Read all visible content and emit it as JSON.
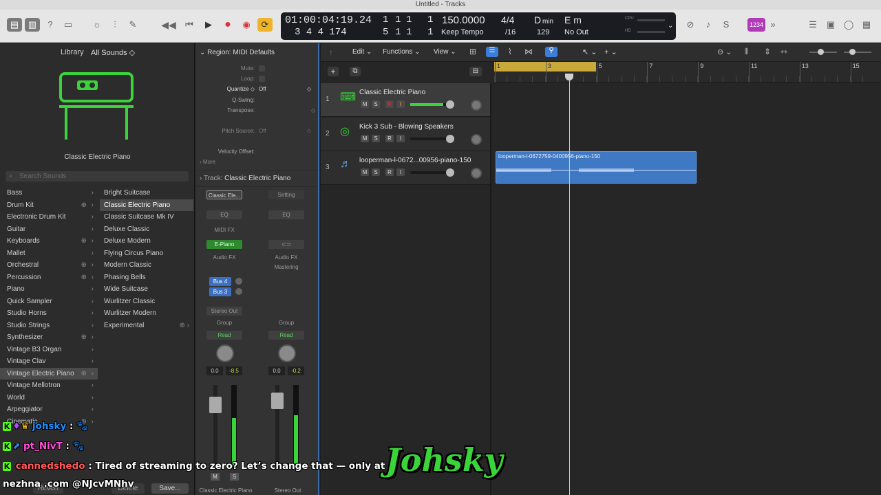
{
  "window": {
    "title": "Untitled - Tracks"
  },
  "lcd": {
    "smpte": "01:00:04:19.24",
    "smpte_sub": "3 4 4 174",
    "bars_top": [
      "1",
      "1",
      "1",
      "1"
    ],
    "bars_bottom": [
      "5",
      "1",
      "1",
      "1"
    ],
    "tempo": "150.0000",
    "tempo_mode": "Keep Tempo",
    "sig_top": "4/4",
    "sig_bottom": "/16",
    "key": "D",
    "key_sub": "min",
    "key_count": "129",
    "chord": "E m",
    "chord_sub": "No Out",
    "cpu": "CPU",
    "hd": "HD",
    "count_in": "1234"
  },
  "library": {
    "title": "Library",
    "filter": "All Sounds ◇",
    "patch_name": "Classic Electric Piano",
    "search_placeholder": "Search Sounds",
    "categories": [
      "Bass",
      "Drum Kit",
      "Electronic Drum Kit",
      "Guitar",
      "Keyboards",
      "Mallet",
      "Orchestral",
      "Percussion",
      "Piano",
      "Quick Sampler",
      "Studio Horns",
      "Studio Strings",
      "Synthesizer",
      "Vintage B3 Organ",
      "Vintage Clav",
      "Vintage Electric Piano",
      "Vintage Mellotron",
      "World",
      "Arpeggiator",
      "Cinematic"
    ],
    "sounds": [
      "Bright Suitcase",
      "Classic Electric Piano",
      "Classic Suitcase Mk IV",
      "Deluxe Classic",
      "Deluxe Modern",
      "Flying Circus Piano",
      "Modern Classic",
      "Phasing Bells",
      "Wide Suitcase",
      "Wurlitzer Classic",
      "Wurlitzer Modern",
      "Experimental"
    ],
    "revert": "Revert",
    "delete": "Delete",
    "save": "Save..."
  },
  "inspector": {
    "region_title": "Region: MIDI Defaults",
    "mute": "Mute:",
    "loop": "Loop:",
    "quantize": "Quantize ◇",
    "quantize_val": "Off",
    "qswing": "Q-Swing:",
    "transpose": "Transpose:",
    "pitch_source": "Pitch Source:",
    "pitch_val": "Off",
    "velocity": "Velocity Offset:",
    "more": "More",
    "track_title": "Track:",
    "track_name": "Classic Electric Piano",
    "strip1": {
      "name": "Classic Ele...",
      "eq": "EQ",
      "midifx": "MIDI FX",
      "inst": "E-Piano",
      "audiofx": "Audio FX",
      "bus1": "Bus 4",
      "bus2": "Bus 3",
      "out": "Stereo Out",
      "group": "Group",
      "read": "Read",
      "pan": "0.0",
      "level": "-8.5",
      "label": "Classic Electric Piano"
    },
    "strip2": {
      "name": "Setting",
      "eq": "EQ",
      "audiofx": "Audio FX",
      "mastering": "Mastering",
      "group": "Group",
      "read": "Read",
      "pan": "0.0",
      "level": "-0.2",
      "label": "Stereo Out"
    },
    "mute_btn": "M",
    "solo_btn": "S"
  },
  "tracks_menu": {
    "edit": "Edit",
    "functions": "Functions",
    "view": "View"
  },
  "ruler": [
    "1",
    "3",
    "5",
    "7",
    "9",
    "11",
    "13",
    "15"
  ],
  "tracks": [
    {
      "num": "1",
      "name": "Classic Electric Piano",
      "m": "M",
      "s": "S",
      "r": "R",
      "i": "I"
    },
    {
      "num": "2",
      "name": "Kick 3 Sub - Blowing Speakers",
      "m": "M",
      "s": "S",
      "r": "R",
      "i": "I"
    },
    {
      "num": "3",
      "name": "looperman-l-0672...00956-piano-150",
      "m": "M",
      "s": "S",
      "r": "R",
      "i": "I"
    }
  ],
  "region": {
    "name": "looperman-l-0672759-0400956-piano-150"
  },
  "chat": [
    {
      "user": "johsky",
      "text": ":"
    },
    {
      "user": "pt_NivT",
      "text": ":"
    },
    {
      "user": "cannedshedo",
      "text": ": Tired of streaming to zero? Let’s change that — only at"
    }
  ],
  "chat_line2": "nezhna .com @NJcvMNhv",
  "overlay": "Johsky",
  "colors": {
    "accent": "#3b7dd8",
    "record": "#e0303a",
    "cycle": "#f0b429",
    "green": "#3ad43a",
    "chat_kick": "#53fc18"
  }
}
